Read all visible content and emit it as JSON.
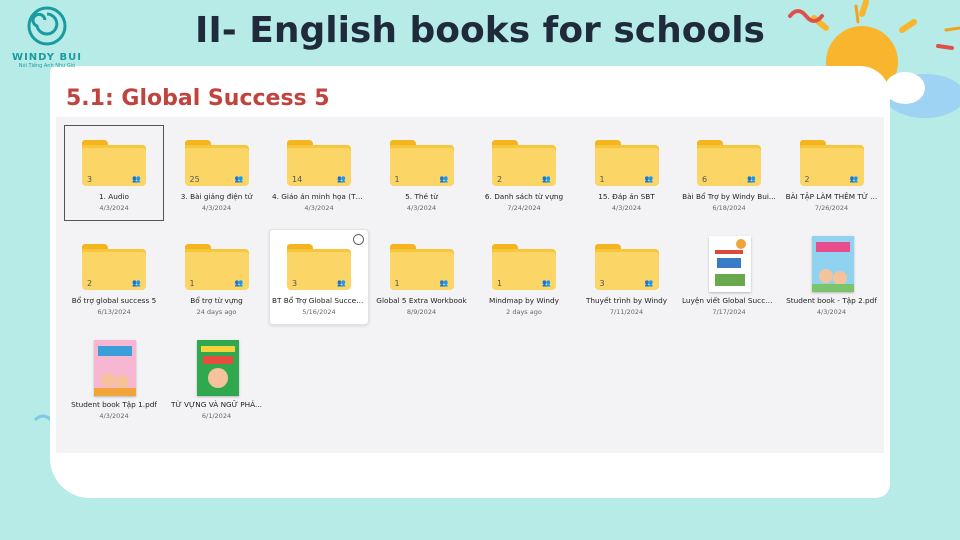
{
  "brand": {
    "name": "WINDY BUI",
    "tagline": "Nói Tiếng Anh Như Gió"
  },
  "slide": {
    "title": "II- English books for schools",
    "subtitle": "5.1: Global Success 5"
  },
  "colors": {
    "background": "#b7ebe8",
    "title": "#1f2a3a",
    "subtitle": "#c0443d",
    "folder": "#fbd666"
  },
  "items": [
    {
      "kind": "folder",
      "name": "1. Audio",
      "date": "4/3/2024",
      "count": "3",
      "icon": "shared-icon",
      "state": "focused"
    },
    {
      "kind": "folder",
      "name": "3. Bài giảng điện tử",
      "date": "4/3/2024",
      "count": "25",
      "icon": "shared-icon"
    },
    {
      "kind": "folder",
      "name": "4. Giáo án minh họa (Th...",
      "date": "4/3/2024",
      "count": "14",
      "icon": "shared-icon"
    },
    {
      "kind": "folder",
      "name": "5. Thẻ từ",
      "date": "4/3/2024",
      "count": "1",
      "icon": "shared-icon"
    },
    {
      "kind": "folder",
      "name": "6. Danh sách từ vựng",
      "date": "7/24/2024",
      "count": "2",
      "icon": "shared-icon"
    },
    {
      "kind": "folder",
      "name": "15. Đáp án SBT",
      "date": "4/3/2024",
      "count": "1",
      "icon": "shared-icon"
    },
    {
      "kind": "folder",
      "name": "Bài Bổ Trợ by Windy Bui...",
      "date": "6/18/2024",
      "count": "6",
      "icon": "shared-icon"
    },
    {
      "kind": "folder",
      "name": "BÀI TẬP LÀM THÊM TỪ ...",
      "date": "7/26/2024",
      "count": "2",
      "icon": "shared-icon"
    },
    {
      "kind": "folder",
      "name": "Bổ trợ global success 5",
      "date": "6/13/2024",
      "count": "2",
      "icon": "shared-icon"
    },
    {
      "kind": "folder",
      "name": "Bổ trợ từ vựng",
      "date": "24 days ago",
      "count": "1",
      "icon": "shared-icon"
    },
    {
      "kind": "folder",
      "name": "BT Bổ Trợ Global Succes...",
      "date": "5/16/2024",
      "count": "3",
      "icon": "shared-icon",
      "state": "hovered"
    },
    {
      "kind": "folder",
      "name": "Global 5 Extra Workbook",
      "date": "8/9/2024",
      "count": "1",
      "icon": "shared-icon"
    },
    {
      "kind": "folder",
      "name": "Mindmap by Windy",
      "date": "2 days ago",
      "count": "1",
      "icon": "shared-icon"
    },
    {
      "kind": "folder",
      "name": "Thuyết trình by Windy",
      "date": "7/11/2024",
      "count": "3",
      "icon": "shared-icon"
    },
    {
      "kind": "file",
      "name": "Luyện viết Global Succe...",
      "date": "7/17/2024",
      "thumb": "copybook"
    },
    {
      "kind": "file",
      "name": "Student book - Tập 2.pdf",
      "date": "4/3/2024",
      "thumb": "studentbook"
    },
    {
      "kind": "file",
      "name": "Student book Tập 1.pdf",
      "date": "4/3/2024",
      "thumb": "studentbook-pink"
    },
    {
      "kind": "file",
      "name": "TỪ VỰNG VÀ NGỮ PHÁ...",
      "date": "6/1/2024",
      "thumb": "vocab-green"
    }
  ]
}
